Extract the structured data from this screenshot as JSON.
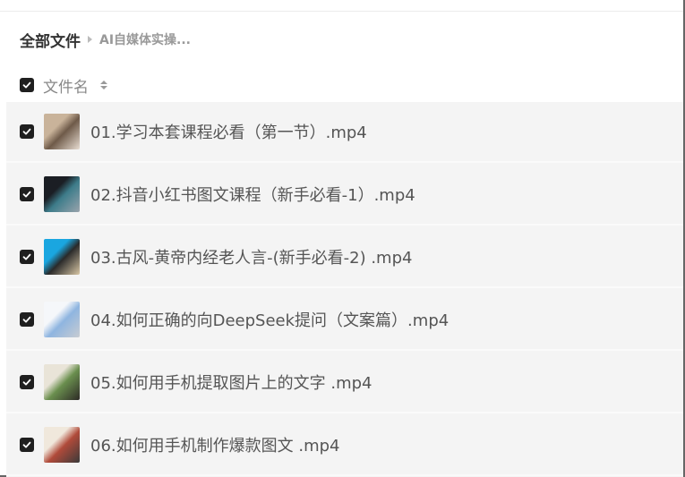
{
  "breadcrumb": {
    "root": "全部文件",
    "current": "AI自媒体实操..."
  },
  "list_header": {
    "label": "文件名"
  },
  "files": [
    {
      "name": "01.学习本套课程必看（第一节）.mp4",
      "thumb_icon": "video-thumbnail-icon",
      "thumb_colors": [
        "#c9b39a",
        "#6e5a49",
        "#e8ddd2"
      ]
    },
    {
      "name": "02.抖音小红书图文课程（新手必看-1）.mp4",
      "thumb_icon": "video-thumbnail-icon",
      "thumb_colors": [
        "#1b1e24",
        "#3d7c8a",
        "#9aa4ad"
      ]
    },
    {
      "name": "03.古风-黄帝内经老人言-(新手必看-2) .mp4",
      "thumb_icon": "video-thumbnail-icon",
      "thumb_colors": [
        "#1aa6e0",
        "#2a2a2a",
        "#d9c7a5"
      ]
    },
    {
      "name": "04.如何正确的向DeepSeek提问（文案篇）.mp4",
      "thumb_icon": "video-thumbnail-icon",
      "thumb_colors": [
        "#f5f7fa",
        "#8fb5e0",
        "#c8ccd2"
      ]
    },
    {
      "name": "05.如何用手机提取图片上的文字 .mp4",
      "thumb_icon": "video-thumbnail-icon",
      "thumb_colors": [
        "#e9e4d8",
        "#6a8f4e",
        "#2d2a26"
      ]
    },
    {
      "name": "06.如何用手机制作爆款图文 .mp4",
      "thumb_icon": "video-thumbnail-icon",
      "thumb_colors": [
        "#f0e8dc",
        "#b04a3a",
        "#3a3a3a"
      ]
    }
  ],
  "colors": {
    "checkbox": "#1f1f1f",
    "row_bg": "#f4f4f4",
    "text": "#555555"
  }
}
